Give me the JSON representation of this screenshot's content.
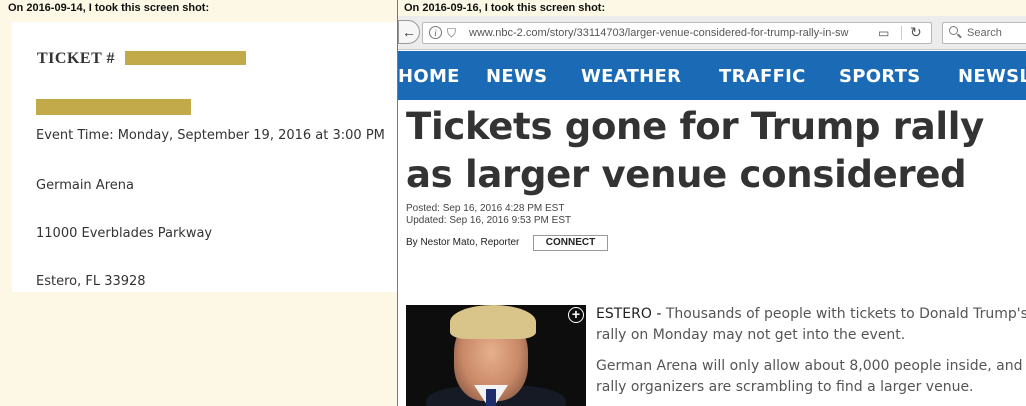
{
  "left": {
    "caption": "On 2016-09-14, I took this screen shot:",
    "ticket": {
      "title": "TICKET #",
      "event_time": "Event Time: Monday, September 19, 2016 at 3:00 PM",
      "venue": "Germain Arena",
      "address": "11000 Everblades Parkway",
      "city": "Estero, FL 33928"
    },
    "redaction_color": "#c2a94a"
  },
  "right": {
    "caption": "On 2016-09-16, I took this screen shot:",
    "browser": {
      "url": "www.nbc-2.com/story/33114703/larger-venue-considered-for-trump-rally-in-sw",
      "search_placeholder": "Search"
    },
    "nav": {
      "color": "#1a6ab5",
      "items": [
        "HOME",
        "NEWS",
        "WEATHER",
        "TRAFFIC",
        "SPORTS",
        "NEWSL"
      ]
    },
    "article": {
      "headline": "Tickets gone for Trump rally as larger venue considered",
      "posted": "Posted: Sep 16, 2016 4:28 PM EST",
      "updated": "Updated: Sep 16, 2016 9:53 PM EST",
      "byline": "By Nestor Mato, Reporter",
      "connect_label": "CONNECT",
      "dateline": "ESTERO -",
      "para1": "Thousands of people with tickets to Donald Trump's rally on Monday may not get into the event.",
      "para2": "German Arena will only allow about 8,000 people inside, and rally organizers are scrambling to find a larger venue."
    }
  }
}
